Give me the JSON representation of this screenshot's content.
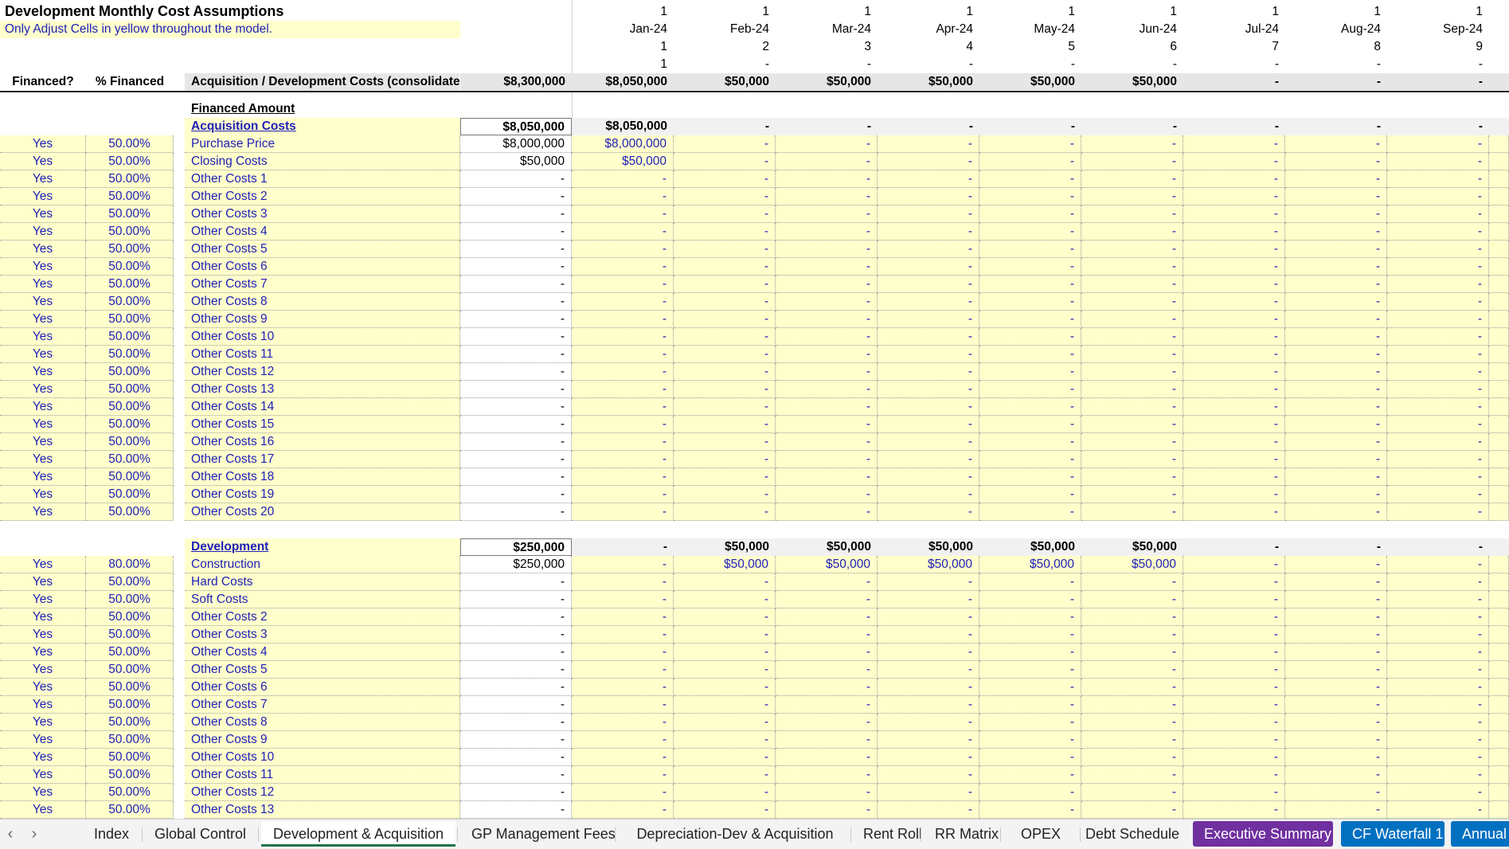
{
  "header": {
    "title": "Development Monthly Cost Assumptions",
    "subtitle": "Only Adjust Cells in yellow throughout the model.",
    "col_financed": "Financed?",
    "col_pct": "% Financed",
    "summary_label": "Acquisition / Development Costs (consolidated)",
    "summary_total": "$8,300,000",
    "summary_months": [
      "$8,050,000",
      "$50,000",
      "$50,000",
      "$50,000",
      "$50,000",
      "$50,000",
      "-",
      "-",
      "-"
    ]
  },
  "months": {
    "flags": [
      "1",
      "1",
      "1",
      "1",
      "1",
      "1",
      "1",
      "1",
      "1"
    ],
    "labels": [
      "Jan-24",
      "Feb-24",
      "Mar-24",
      "Apr-24",
      "May-24",
      "Jun-24",
      "Jul-24",
      "Aug-24",
      "Sep-24"
    ],
    "numbers": [
      "1",
      "2",
      "3",
      "4",
      "5",
      "6",
      "7",
      "8",
      "9"
    ],
    "row4": [
      "1",
      "-",
      "-",
      "-",
      "-",
      "-",
      "-",
      "-",
      "-"
    ]
  },
  "acquisition": {
    "section_label": "Financed Amount",
    "header": {
      "label": "Acquisition Costs",
      "total": "$8,050,000",
      "months": [
        "$8,050,000",
        "-",
        "-",
        "-",
        "-",
        "-",
        "-",
        "-",
        "-"
      ]
    },
    "rows": [
      {
        "financed": "Yes",
        "pct": "50.00%",
        "label": "Purchase Price",
        "total": "$8,000,000",
        "months": [
          "$8,000,000",
          "-",
          "-",
          "-",
          "-",
          "-",
          "-",
          "-",
          "-"
        ]
      },
      {
        "financed": "Yes",
        "pct": "50.00%",
        "label": "Closing Costs",
        "total": "$50,000",
        "months": [
          "$50,000",
          "-",
          "-",
          "-",
          "-",
          "-",
          "-",
          "-",
          "-"
        ]
      },
      {
        "financed": "Yes",
        "pct": "50.00%",
        "label": "Other Costs 1",
        "total": "-",
        "months": [
          "-",
          "-",
          "-",
          "-",
          "-",
          "-",
          "-",
          "-",
          "-"
        ]
      },
      {
        "financed": "Yes",
        "pct": "50.00%",
        "label": "Other Costs 2",
        "total": "-",
        "months": [
          "-",
          "-",
          "-",
          "-",
          "-",
          "-",
          "-",
          "-",
          "-"
        ]
      },
      {
        "financed": "Yes",
        "pct": "50.00%",
        "label": "Other Costs 3",
        "total": "-",
        "months": [
          "-",
          "-",
          "-",
          "-",
          "-",
          "-",
          "-",
          "-",
          "-"
        ]
      },
      {
        "financed": "Yes",
        "pct": "50.00%",
        "label": "Other Costs 4",
        "total": "-",
        "months": [
          "-",
          "-",
          "-",
          "-",
          "-",
          "-",
          "-",
          "-",
          "-"
        ]
      },
      {
        "financed": "Yes",
        "pct": "50.00%",
        "label": "Other Costs 5",
        "total": "-",
        "months": [
          "-",
          "-",
          "-",
          "-",
          "-",
          "-",
          "-",
          "-",
          "-"
        ]
      },
      {
        "financed": "Yes",
        "pct": "50.00%",
        "label": "Other Costs 6",
        "total": "-",
        "months": [
          "-",
          "-",
          "-",
          "-",
          "-",
          "-",
          "-",
          "-",
          "-"
        ]
      },
      {
        "financed": "Yes",
        "pct": "50.00%",
        "label": "Other Costs 7",
        "total": "-",
        "months": [
          "-",
          "-",
          "-",
          "-",
          "-",
          "-",
          "-",
          "-",
          "-"
        ]
      },
      {
        "financed": "Yes",
        "pct": "50.00%",
        "label": "Other Costs 8",
        "total": "-",
        "months": [
          "-",
          "-",
          "-",
          "-",
          "-",
          "-",
          "-",
          "-",
          "-"
        ]
      },
      {
        "financed": "Yes",
        "pct": "50.00%",
        "label": "Other Costs 9",
        "total": "-",
        "months": [
          "-",
          "-",
          "-",
          "-",
          "-",
          "-",
          "-",
          "-",
          "-"
        ]
      },
      {
        "financed": "Yes",
        "pct": "50.00%",
        "label": "Other Costs 10",
        "total": "-",
        "months": [
          "-",
          "-",
          "-",
          "-",
          "-",
          "-",
          "-",
          "-",
          "-"
        ]
      },
      {
        "financed": "Yes",
        "pct": "50.00%",
        "label": "Other Costs 11",
        "total": "-",
        "months": [
          "-",
          "-",
          "-",
          "-",
          "-",
          "-",
          "-",
          "-",
          "-"
        ]
      },
      {
        "financed": "Yes",
        "pct": "50.00%",
        "label": "Other Costs 12",
        "total": "-",
        "months": [
          "-",
          "-",
          "-",
          "-",
          "-",
          "-",
          "-",
          "-",
          "-"
        ]
      },
      {
        "financed": "Yes",
        "pct": "50.00%",
        "label": "Other Costs 13",
        "total": "-",
        "months": [
          "-",
          "-",
          "-",
          "-",
          "-",
          "-",
          "-",
          "-",
          "-"
        ]
      },
      {
        "financed": "Yes",
        "pct": "50.00%",
        "label": "Other Costs 14",
        "total": "-",
        "months": [
          "-",
          "-",
          "-",
          "-",
          "-",
          "-",
          "-",
          "-",
          "-"
        ]
      },
      {
        "financed": "Yes",
        "pct": "50.00%",
        "label": "Other Costs 15",
        "total": "-",
        "months": [
          "-",
          "-",
          "-",
          "-",
          "-",
          "-",
          "-",
          "-",
          "-"
        ]
      },
      {
        "financed": "Yes",
        "pct": "50.00%",
        "label": "Other Costs 16",
        "total": "-",
        "months": [
          "-",
          "-",
          "-",
          "-",
          "-",
          "-",
          "-",
          "-",
          "-"
        ]
      },
      {
        "financed": "Yes",
        "pct": "50.00%",
        "label": "Other Costs 17",
        "total": "-",
        "months": [
          "-",
          "-",
          "-",
          "-",
          "-",
          "-",
          "-",
          "-",
          "-"
        ]
      },
      {
        "financed": "Yes",
        "pct": "50.00%",
        "label": "Other Costs 18",
        "total": "-",
        "months": [
          "-",
          "-",
          "-",
          "-",
          "-",
          "-",
          "-",
          "-",
          "-"
        ]
      },
      {
        "financed": "Yes",
        "pct": "50.00%",
        "label": "Other Costs 19",
        "total": "-",
        "months": [
          "-",
          "-",
          "-",
          "-",
          "-",
          "-",
          "-",
          "-",
          "-"
        ]
      },
      {
        "financed": "Yes",
        "pct": "50.00%",
        "label": "Other Costs 20",
        "total": "-",
        "months": [
          "-",
          "-",
          "-",
          "-",
          "-",
          "-",
          "-",
          "-",
          "-"
        ]
      }
    ]
  },
  "development": {
    "header": {
      "label": "Development",
      "total": "$250,000",
      "months": [
        "-",
        "$50,000",
        "$50,000",
        "$50,000",
        "$50,000",
        "$50,000",
        "-",
        "-",
        "-"
      ]
    },
    "rows": [
      {
        "financed": "Yes",
        "pct": "80.00%",
        "label": "Construction",
        "total": "$250,000",
        "months": [
          "-",
          "$50,000",
          "$50,000",
          "$50,000",
          "$50,000",
          "$50,000",
          "-",
          "-",
          "-"
        ]
      },
      {
        "financed": "Yes",
        "pct": "50.00%",
        "label": "Hard Costs",
        "total": "-",
        "months": [
          "-",
          "-",
          "-",
          "-",
          "-",
          "-",
          "-",
          "-",
          "-"
        ]
      },
      {
        "financed": "Yes",
        "pct": "50.00%",
        "label": "Soft Costs",
        "total": "-",
        "months": [
          "-",
          "-",
          "-",
          "-",
          "-",
          "-",
          "-",
          "-",
          "-"
        ]
      },
      {
        "financed": "Yes",
        "pct": "50.00%",
        "label": "Other Costs 2",
        "total": "-",
        "months": [
          "-",
          "-",
          "-",
          "-",
          "-",
          "-",
          "-",
          "-",
          "-"
        ]
      },
      {
        "financed": "Yes",
        "pct": "50.00%",
        "label": "Other Costs 3",
        "total": "-",
        "months": [
          "-",
          "-",
          "-",
          "-",
          "-",
          "-",
          "-",
          "-",
          "-"
        ]
      },
      {
        "financed": "Yes",
        "pct": "50.00%",
        "label": "Other Costs 4",
        "total": "-",
        "months": [
          "-",
          "-",
          "-",
          "-",
          "-",
          "-",
          "-",
          "-",
          "-"
        ]
      },
      {
        "financed": "Yes",
        "pct": "50.00%",
        "label": "Other Costs 5",
        "total": "-",
        "months": [
          "-",
          "-",
          "-",
          "-",
          "-",
          "-",
          "-",
          "-",
          "-"
        ]
      },
      {
        "financed": "Yes",
        "pct": "50.00%",
        "label": "Other Costs 6",
        "total": "-",
        "months": [
          "-",
          "-",
          "-",
          "-",
          "-",
          "-",
          "-",
          "-",
          "-"
        ]
      },
      {
        "financed": "Yes",
        "pct": "50.00%",
        "label": "Other Costs 7",
        "total": "-",
        "months": [
          "-",
          "-",
          "-",
          "-",
          "-",
          "-",
          "-",
          "-",
          "-"
        ]
      },
      {
        "financed": "Yes",
        "pct": "50.00%",
        "label": "Other Costs 8",
        "total": "-",
        "months": [
          "-",
          "-",
          "-",
          "-",
          "-",
          "-",
          "-",
          "-",
          "-"
        ]
      },
      {
        "financed": "Yes",
        "pct": "50.00%",
        "label": "Other Costs 9",
        "total": "-",
        "months": [
          "-",
          "-",
          "-",
          "-",
          "-",
          "-",
          "-",
          "-",
          "-"
        ]
      },
      {
        "financed": "Yes",
        "pct": "50.00%",
        "label": "Other Costs 10",
        "total": "-",
        "months": [
          "-",
          "-",
          "-",
          "-",
          "-",
          "-",
          "-",
          "-",
          "-"
        ]
      },
      {
        "financed": "Yes",
        "pct": "50.00%",
        "label": "Other Costs 11",
        "total": "-",
        "months": [
          "-",
          "-",
          "-",
          "-",
          "-",
          "-",
          "-",
          "-",
          "-"
        ]
      },
      {
        "financed": "Yes",
        "pct": "50.00%",
        "label": "Other Costs 12",
        "total": "-",
        "months": [
          "-",
          "-",
          "-",
          "-",
          "-",
          "-",
          "-",
          "-",
          "-"
        ]
      },
      {
        "financed": "Yes",
        "pct": "50.00%",
        "label": "Other Costs 13",
        "total": "-",
        "months": [
          "-",
          "-",
          "-",
          "-",
          "-",
          "-",
          "-",
          "-",
          "-"
        ]
      }
    ]
  },
  "tabs": [
    {
      "label": "Index",
      "style": "normal"
    },
    {
      "label": "Global Control",
      "style": "normal"
    },
    {
      "label": "Development & Acquisition",
      "style": "active"
    },
    {
      "label": "GP Management Fees",
      "style": "normal"
    },
    {
      "label": "Depreciation-Dev & Acquisition",
      "style": "normal"
    },
    {
      "label": "Rent Roll",
      "style": "normal"
    },
    {
      "label": "RR Matrix",
      "style": "normal"
    },
    {
      "label": "OPEX",
      "style": "normal"
    },
    {
      "label": "Debt Schedule",
      "style": "normal"
    },
    {
      "label": "Executive Summary",
      "style": "purple"
    },
    {
      "label": "CF Waterfall 1",
      "style": "blue"
    },
    {
      "label": "Annual",
      "style": "blue"
    }
  ],
  "nav": {
    "prev_icon": "‹",
    "next_icon": "›"
  },
  "colors": {
    "input_yellow": "#ffffcc",
    "link_blue": "#1f1fb8",
    "active_tab_green": "#217346",
    "purple_tab": "#7030a0",
    "blue_tab": "#0070c0"
  }
}
